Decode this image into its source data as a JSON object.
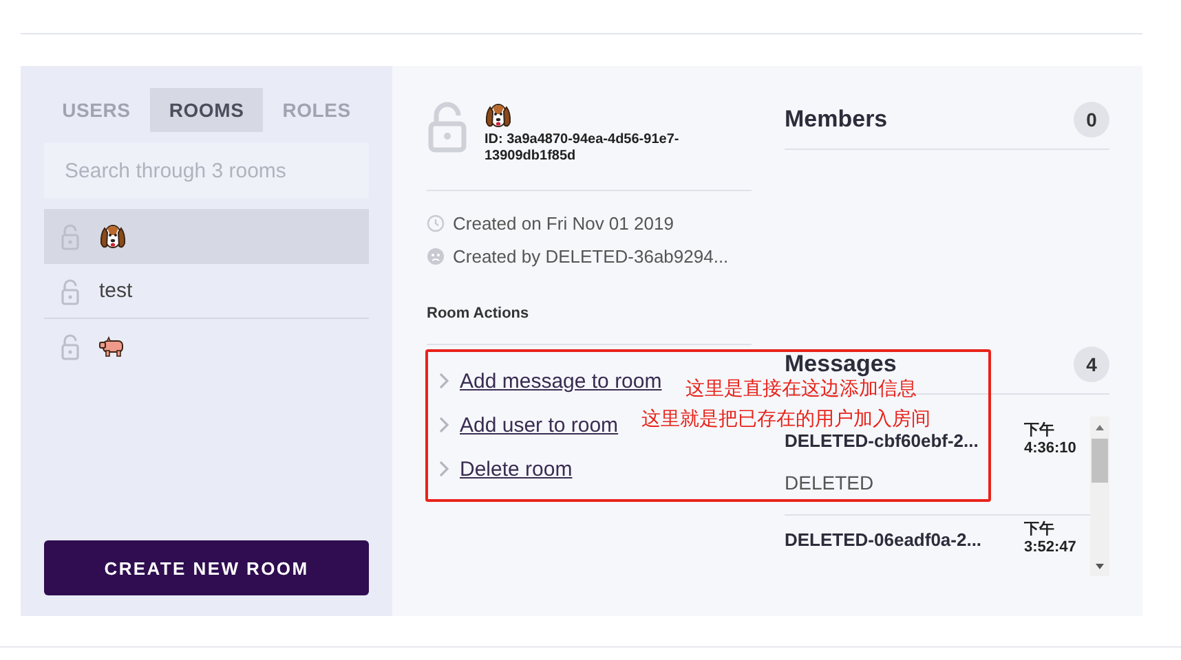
{
  "sidebar": {
    "tabs": [
      {
        "label": "USERS",
        "selected": false
      },
      {
        "label": "ROOMS",
        "selected": true
      },
      {
        "label": "ROLES",
        "selected": false
      }
    ],
    "search": {
      "placeholder": "Search through 3 rooms"
    },
    "rooms": [
      {
        "kind": "dog-emoji",
        "selected": true
      },
      {
        "kind": "text",
        "name": "test",
        "selected": false
      },
      {
        "kind": "pig-emoji",
        "selected": false
      }
    ],
    "create_button": "CREATE NEW ROOM"
  },
  "room": {
    "kind": "dog-emoji",
    "id": "ID: 3a9a4870-94ea-4d56-91e7-13909db1f85d",
    "created_on": "Created on Fri Nov 01 2019",
    "created_by": "Created by DELETED-36ab9294...",
    "actions_title": "Room Actions",
    "actions": [
      "Add message to room",
      "Add user to room",
      "Delete room"
    ]
  },
  "members": {
    "title": "Members",
    "count": "0"
  },
  "messages": {
    "title": "Messages",
    "count": "4",
    "items": [
      {
        "sender": "DELETED-cbf60ebf-2...",
        "time_period": "下午",
        "time": "4:36:10",
        "text": "DELETED"
      },
      {
        "sender": "DELETED-06eadf0a-2...",
        "time_period": "下午",
        "time": "3:52:47"
      }
    ]
  },
  "annotations": [
    {
      "text": "这里是直接在这边添加信息"
    },
    {
      "text": "这里就是把已存在的用户加入房间"
    }
  ]
}
